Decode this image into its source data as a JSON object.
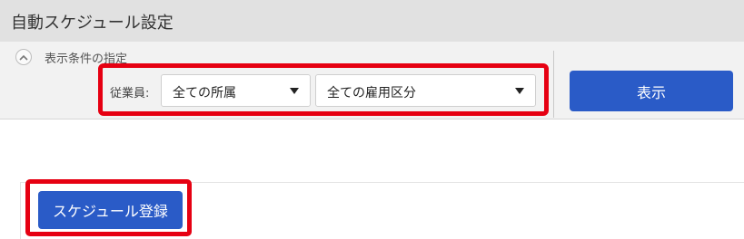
{
  "page": {
    "title": "自動スケジュール設定"
  },
  "conditions": {
    "section_title": "表示条件の指定",
    "toggle_icon": "chevron-up-icon",
    "employee_label": "従業員:",
    "department_select": {
      "value": "全ての所属",
      "icon": "caret-down-icon"
    },
    "employment_type_select": {
      "value": "全ての雇用区分",
      "icon": "caret-down-icon"
    },
    "show_button_label": "表示"
  },
  "actions": {
    "register_button_label": "スケジュール登録"
  },
  "colors": {
    "primary": "#2a5bc7",
    "highlight": "#e60012",
    "title_bar_bg": "#e1e1e1",
    "panel_bg": "#f2f2f2"
  }
}
